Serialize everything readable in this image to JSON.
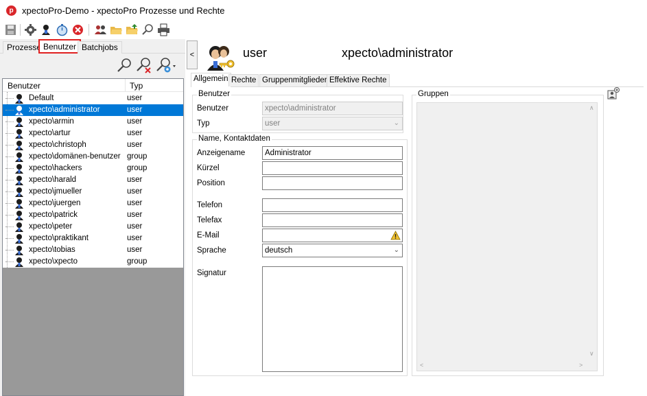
{
  "window": {
    "title": "xpectoPro-Demo - xpectoPro Prozesse und Rechte"
  },
  "toolbar": {
    "buttons": [
      "save-icon",
      "settings-icon",
      "user-icon",
      "stopwatch-icon",
      "cancel-icon",
      "user-group-icon",
      "folder-open-icon",
      "folder-up-icon",
      "search-icon",
      "print-icon"
    ]
  },
  "left_tabs": [
    {
      "label": "Prozesse",
      "active": false
    },
    {
      "label": "Benutzer",
      "active": true
    },
    {
      "label": "Batchjobs",
      "active": false
    }
  ],
  "list": {
    "columns": [
      "Benutzer",
      "Typ"
    ],
    "rows": [
      {
        "name": "Default",
        "type": "user"
      },
      {
        "name": "xpecto\\administrator",
        "type": "user",
        "selected": true
      },
      {
        "name": "xpecto\\armin",
        "type": "user"
      },
      {
        "name": "xpecto\\artur",
        "type": "user"
      },
      {
        "name": "xpecto\\christoph",
        "type": "user"
      },
      {
        "name": "xpecto\\domänen-benutzer",
        "type": "group"
      },
      {
        "name": "xpecto\\hackers",
        "type": "group"
      },
      {
        "name": "xpecto\\harald",
        "type": "user"
      },
      {
        "name": "xpecto\\jmueller",
        "type": "user"
      },
      {
        "name": "xpecto\\juergen",
        "type": "user"
      },
      {
        "name": "xpecto\\patrick",
        "type": "user"
      },
      {
        "name": "xpecto\\peter",
        "type": "user"
      },
      {
        "name": "xpecto\\praktikant",
        "type": "user"
      },
      {
        "name": "xpecto\\tobias",
        "type": "user"
      },
      {
        "name": "xpecto\\xpecto",
        "type": "group"
      }
    ]
  },
  "header": {
    "type": "user",
    "name": "xpecto\\administrator"
  },
  "right_tabs": [
    {
      "label": "Allgemein",
      "active": true
    },
    {
      "label": "Rechte",
      "active": false
    },
    {
      "label": "Gruppenmitglieder",
      "active": false
    },
    {
      "label": "Effektive Rechte",
      "active": false
    }
  ],
  "benutzer_group": {
    "title": "Benutzer",
    "user_label": "Benutzer",
    "user_value": "xpecto\\administrator",
    "type_label": "Typ",
    "type_value": "user"
  },
  "contact_group": {
    "title": "Name, Kontaktdaten",
    "display_name_label": "Anzeigename",
    "display_name_value": "Administrator",
    "short_label": "Kürzel",
    "short_value": "",
    "position_label": "Position",
    "position_value": "",
    "phone_label": "Telefon",
    "phone_value": "",
    "fax_label": "Telefax",
    "fax_value": "",
    "email_label": "E-Mail",
    "email_value": "",
    "language_label": "Sprache",
    "language_value": "deutsch",
    "signature_label": "Signatur",
    "signature_value": ""
  },
  "groups_panel": {
    "title": "Gruppen"
  },
  "colors": {
    "selection": "#0078d7",
    "active_tab_border": "#e02020",
    "list_empty_bg": "#999999"
  }
}
